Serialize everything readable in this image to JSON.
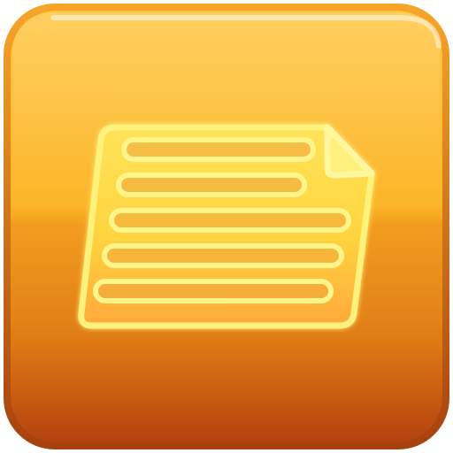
{
  "icon": {
    "name": "document-icon",
    "colors": {
      "tile_top": "#FFC12E",
      "tile_mid": "#F7A722",
      "tile_bottom": "#B9450E",
      "tile_border": "#C7660E",
      "paper_fill": "#FFD24A",
      "paper_outline": "#FFF68C",
      "highlight": "#FFFFFF"
    }
  }
}
